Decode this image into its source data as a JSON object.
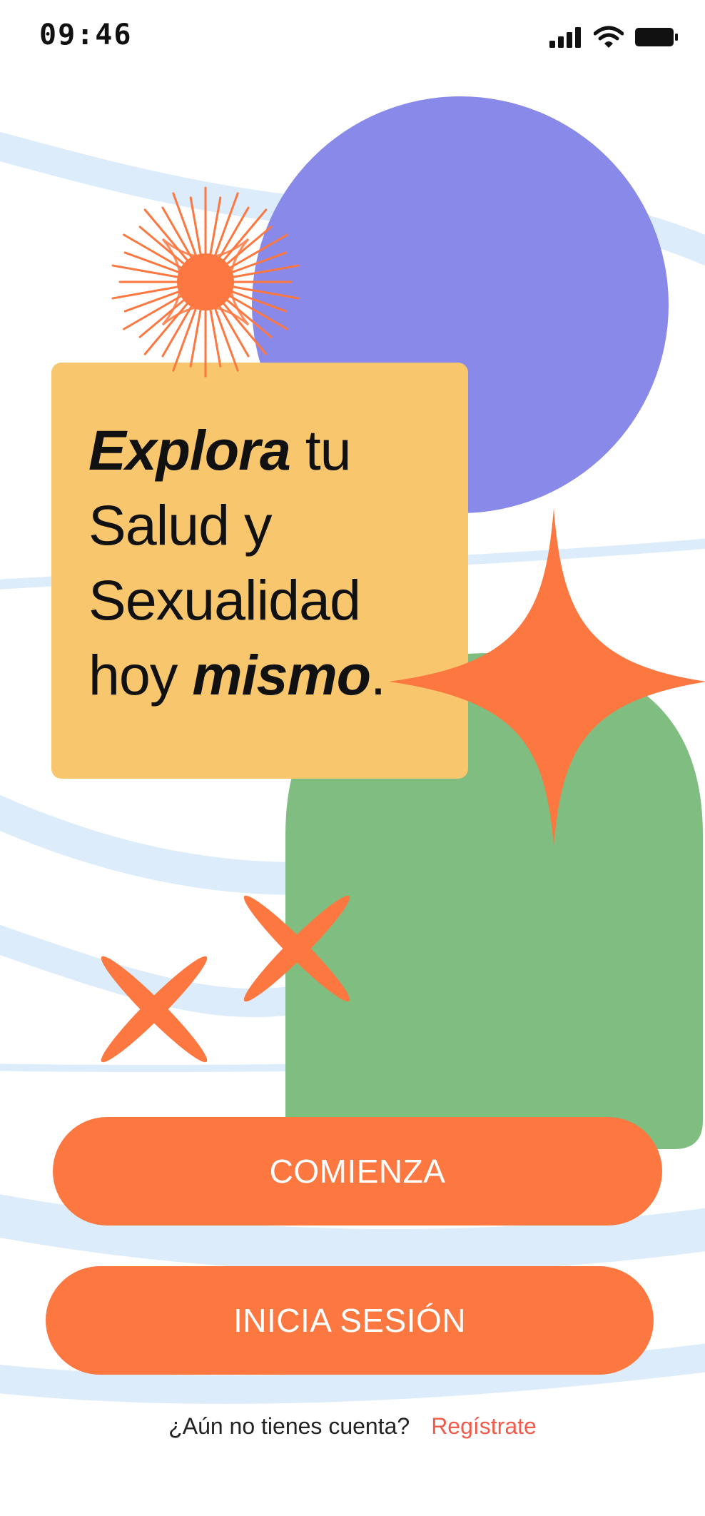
{
  "status_bar": {
    "time": "09:46",
    "icons": [
      "signal-icon",
      "wifi-icon",
      "battery-icon"
    ]
  },
  "headline": {
    "line1_bold": "Explora",
    "line1_rest": " tu",
    "line2": "Salud y",
    "line3": "Sexualidad",
    "line4_regular": "hoy ",
    "line4_bold": "mismo",
    "line4_end": "."
  },
  "actions": {
    "start_label": "COMIENZA",
    "login_label": "INICIA SESIÓN"
  },
  "signup": {
    "question": "¿Aún no tienes cuenta?",
    "link_label": "Regístrate"
  },
  "colors": {
    "accent": "#fd7740",
    "card": "#f8c66c",
    "purple_circle": "#8989ea",
    "green_arch": "#7fbe80",
    "wave": "#dcecfa",
    "link": "#f25a4a"
  }
}
